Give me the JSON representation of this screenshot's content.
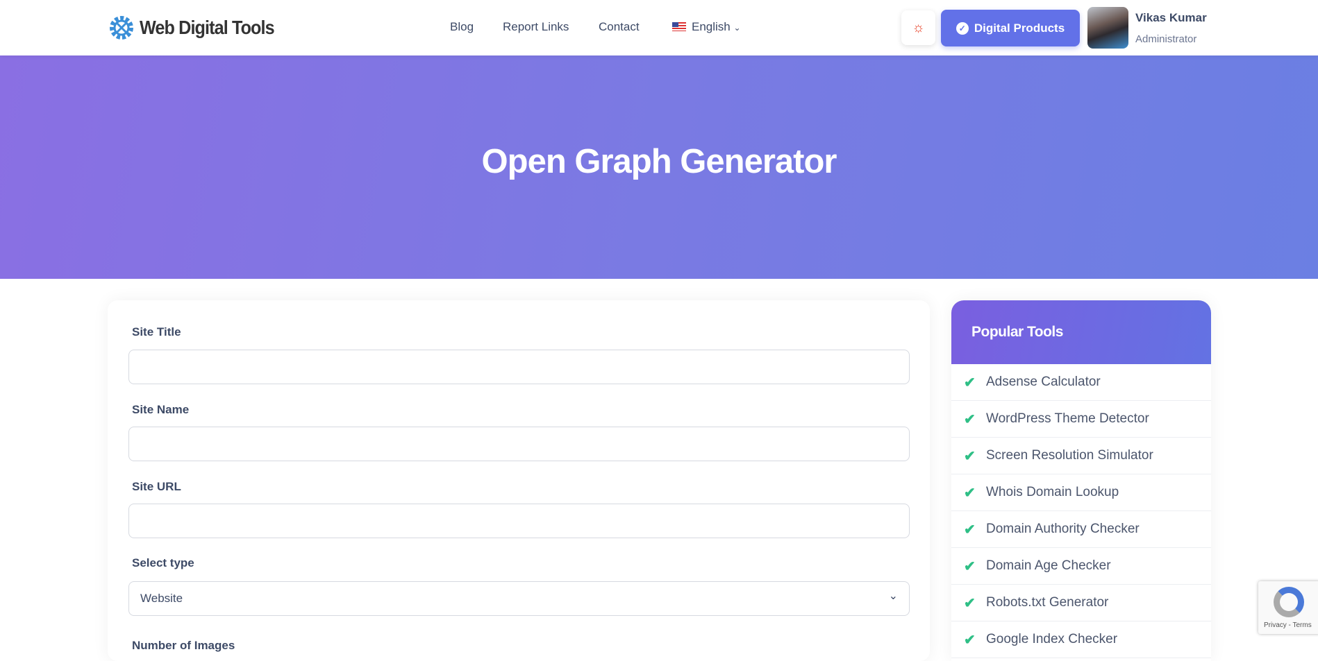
{
  "header": {
    "logo_text": "Web Digital Tools",
    "nav": [
      {
        "label": "Blog"
      },
      {
        "label": "Report Links"
      },
      {
        "label": "Contact"
      }
    ],
    "language": "English",
    "theme_icon": "sun-icon",
    "cta_label": "Digital Products",
    "user": {
      "name": "Vikas Kumar",
      "role": "Administrator"
    }
  },
  "hero": {
    "title": "Open Graph Generator"
  },
  "form": {
    "fields": [
      {
        "label": "Site Title",
        "value": ""
      },
      {
        "label": "Site Name",
        "value": ""
      },
      {
        "label": "Site URL",
        "value": ""
      }
    ],
    "type_label": "Select type",
    "type_value": "Website",
    "images_label": "Number of Images"
  },
  "sidebar": {
    "title": "Popular Tools",
    "items": [
      {
        "label": "Adsense Calculator"
      },
      {
        "label": "WordPress Theme Detector"
      },
      {
        "label": "Screen Resolution Simulator"
      },
      {
        "label": "Whois Domain Lookup"
      },
      {
        "label": "Domain Authority Checker"
      },
      {
        "label": "Domain Age Checker"
      },
      {
        "label": "Robots.txt Generator"
      },
      {
        "label": "Google Index Checker"
      }
    ]
  },
  "recaptcha": {
    "text": "Privacy - Terms"
  },
  "colors": {
    "accent": "#6271e8",
    "hero_start": "#8a6fe3",
    "hero_end": "#6b7fe3",
    "check": "#2fbf86"
  }
}
